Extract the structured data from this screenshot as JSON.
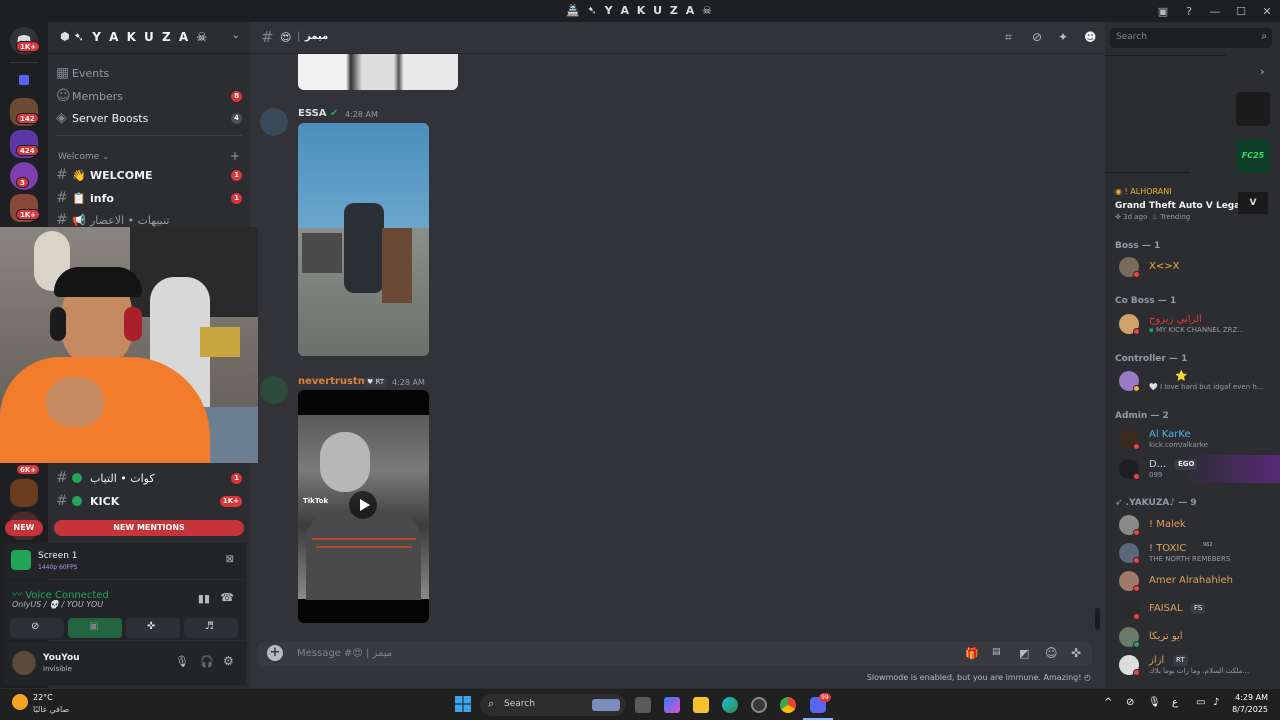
{
  "window": {
    "title": "🏯 ➷ Y A K U Z A ☠"
  },
  "servers": [
    {
      "badge": "1K+"
    },
    {
      "badge": ""
    },
    {
      "badge": "142"
    },
    {
      "badge": "424"
    },
    {
      "badge": "3"
    },
    {
      "badge": "1K+"
    },
    {
      "badge": "6K+"
    }
  ],
  "guild": {
    "name": "➷ Y A K U Z A ☠"
  },
  "sidebar": {
    "top_items": [
      {
        "label": "Events",
        "badge": ""
      },
      {
        "label": "Members",
        "badge": "8"
      },
      {
        "label": "Server Boosts",
        "badge": "4"
      }
    ],
    "category": "Welcome",
    "channels": [
      {
        "icon": "👋",
        "label": "WELCOME",
        "badge": "1"
      },
      {
        "icon": "📋",
        "label": "info",
        "badge": "1"
      },
      {
        "icon": "📢",
        "label": "تنبيهات • الاعضار",
        "badge": ""
      }
    ],
    "lower_channels": [
      {
        "label": "كوات • التياب",
        "badge": "1"
      },
      {
        "label": "KICK",
        "badge": "1K+"
      }
    ],
    "new_label": "NEW",
    "mentions_label": "NEW MENTIONS"
  },
  "stream": {
    "title": "Screen 1",
    "quality": "1440p 60FPS"
  },
  "voice": {
    "status": "Voice Connected",
    "location": "OnlyUS / 💀 / YOU YOU"
  },
  "user": {
    "name": "YouYou",
    "status": "Invisible"
  },
  "channel": {
    "name": "ميمز",
    "emoji": "😍"
  },
  "messages": [
    {
      "author": "ESSA",
      "author_color": "#dbdee1",
      "tag": "",
      "time": "4:28 AM"
    },
    {
      "author": "nevertrustme",
      "author_color": "#e0803a",
      "tag": "RT",
      "time": "4:28 AM",
      "watermark": "TikTok"
    }
  ],
  "composer": {
    "placeholder": "Message #😍 | ميمز",
    "slowmode": "Slowmode is enabled, but you are immune. Amazing!"
  },
  "header_search": {
    "placeholder": "Search"
  },
  "activity": {
    "user": "! ALHORANI",
    "game": "Grand Theft Auto V Legacy",
    "when": "3d ago",
    "tag": "Trending",
    "tile_label": "FC25"
  },
  "member_groups": [
    {
      "title": "Boss — 1",
      "members": [
        {
          "name": "X<>X",
          "color": "#f0b232",
          "status": "",
          "dot": "#f23f43"
        }
      ]
    },
    {
      "title": "Co Boss — 1",
      "members": [
        {
          "name": "الزاني زيزوح",
          "color": "#e8363f",
          "status": "MY KICK CHANNEL ZRZ...",
          "dot": "#f23f43"
        }
      ]
    },
    {
      "title": "Controller — 1",
      "members": [
        {
          "name": "⭐",
          "color": "#f0b232",
          "status": "🤍 I love hard but idgaf even h...",
          "dot": "#f0b232"
        }
      ]
    },
    {
      "title": "Admin — 2",
      "members": [
        {
          "name": "Al KarKe",
          "color": "#4fb5e6",
          "status": "kick.com/alkarke",
          "dot": "#f23f43"
        },
        {
          "name": "D...",
          "color": "#c9cdfb",
          "status": "099",
          "dot": "#f23f43",
          "tag": "EGO"
        }
      ]
    },
    {
      "title": "➶ .YAKUZA♪ — 9",
      "members": [
        {
          "name": "! Malek",
          "color": "#e0a15c",
          "status": "",
          "dot": "#f23f43"
        },
        {
          "name": "! TOXIC",
          "color": "#e0a15c",
          "status": "THE NORTH REMEBERS",
          "dot": "#f23f43",
          "tag": "962"
        },
        {
          "name": "Amer Alrahahleh",
          "color": "#e0a15c",
          "status": "",
          "dot": "#f23f43"
        },
        {
          "name": "FAISAL",
          "color": "#e0a15c",
          "status": "",
          "dot": "#f23f43",
          "tag": "FS"
        },
        {
          "name": "ابو تريكا",
          "color": "#e0a15c",
          "status": "",
          "dot": "#23a559"
        },
        {
          "name": "ازاز",
          "color": "#e0a15c",
          "status": "ملكت السلام، وما رات يوما بلاك...",
          "dot": "#f23f43",
          "tag": "RT"
        }
      ]
    }
  ],
  "taskbar": {
    "weather_temp": "22°C",
    "weather_desc": "صافي غالبًا",
    "search": "Search",
    "lang": "ع",
    "time": "4:29 AM",
    "date": "8/7/2025",
    "discord_badge": "99"
  }
}
